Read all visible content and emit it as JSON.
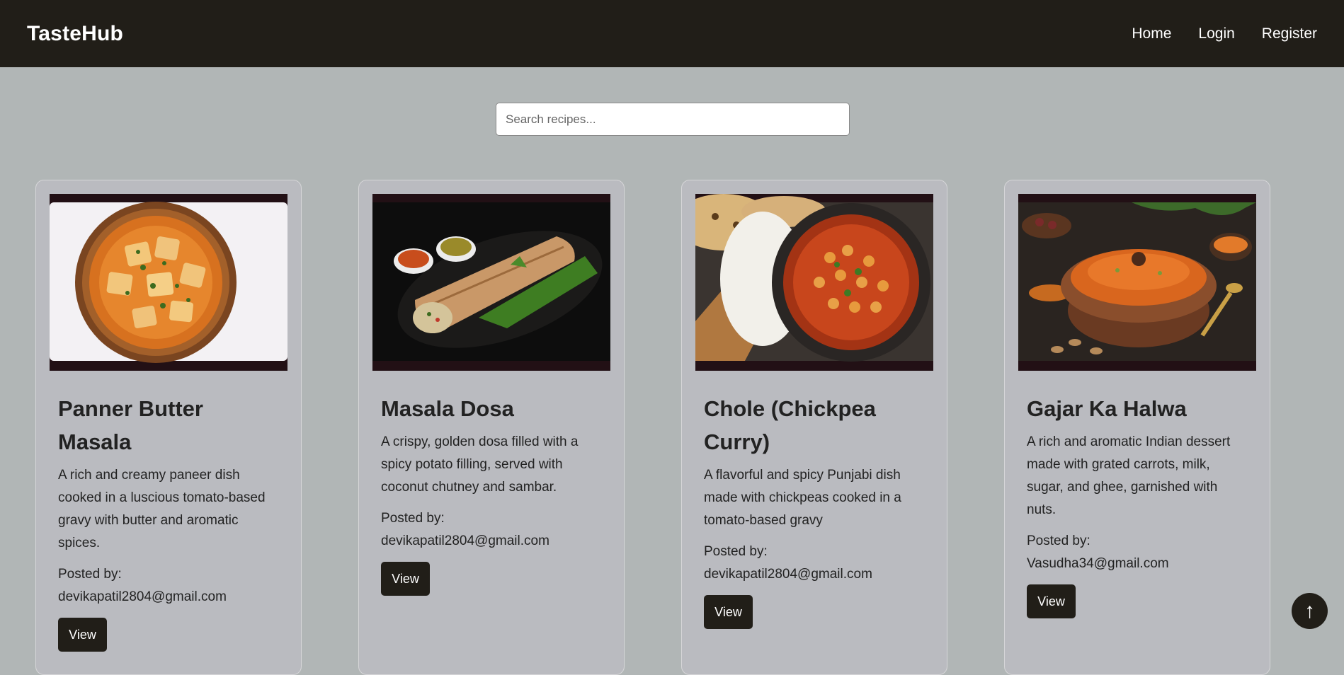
{
  "app": {
    "brand": "TasteHub"
  },
  "nav": {
    "home": "Home",
    "login": "Login",
    "register": "Register"
  },
  "search": {
    "placeholder": "Search recipes...",
    "value": ""
  },
  "recipes": [
    {
      "title": "Panner Butter Masala",
      "description": "A rich and creamy paneer dish cooked in a luscious tomato-based gravy with butter and aromatic spices.",
      "posted_label": "Posted by:",
      "author": "devikapatil2804@gmail.com",
      "button": "View",
      "image": "paneer-butter-masala-photo"
    },
    {
      "title": "Masala Dosa",
      "description": "A crispy, golden dosa filled with a spicy potato filling, served with coconut chutney and sambar.",
      "posted_label": "Posted by:",
      "author": "devikapatil2804@gmail.com",
      "button": "View",
      "image": "masala-dosa-photo"
    },
    {
      "title": "Chole (Chickpea Curry)",
      "description": "A flavorful and spicy Punjabi dish made with chickpeas cooked in a tomato-based gravy",
      "posted_label": "Posted by:",
      "author": "devikapatil2804@gmail.com",
      "button": "View",
      "image": "chole-chickpea-curry-photo"
    },
    {
      "title": "Gajar Ka Halwa",
      "description": "A rich and aromatic Indian dessert made with grated carrots, milk, sugar, and ghee, garnished with nuts.",
      "posted_label": "Posted by:",
      "author": "Vasudha34@gmail.com",
      "button": "View",
      "image": "gajar-ka-halwa-photo"
    }
  ],
  "scroll_top": {
    "icon": "arrow-up-icon",
    "glyph": "↑"
  },
  "colors": {
    "navbar": "#211e18",
    "page_bg": "#b1b6b6",
    "card_bg": "#babbc0",
    "button": "#211e18"
  }
}
